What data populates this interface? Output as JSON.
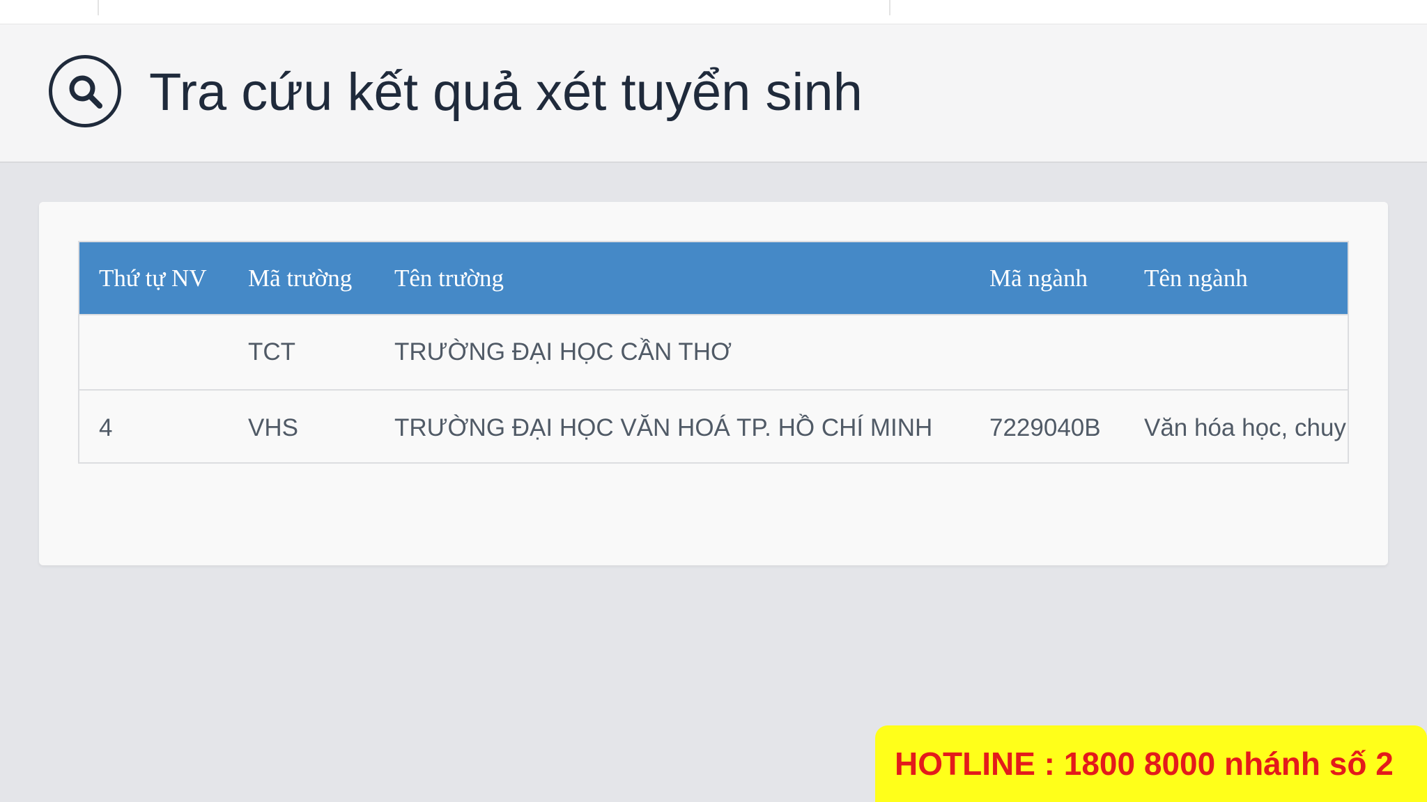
{
  "header": {
    "title": "Tra cứu kết quả xét tuyển sinh",
    "icon": "search-icon"
  },
  "table": {
    "columns": [
      "Thứ tự NV",
      "Mã trường",
      "Tên trường",
      "Mã ngành",
      "Tên ngành"
    ],
    "rows": [
      {
        "order": "",
        "school_code": "TCT",
        "school_name": "TRƯỜNG ĐẠI HỌC CẦN THƠ",
        "major_code": "",
        "major_name": ""
      },
      {
        "order": "4",
        "school_code": "VHS",
        "school_name": "TRƯỜNG ĐẠI HỌC VĂN HOÁ TP. HỒ CHÍ MINH",
        "major_code": "7229040B",
        "major_name": "Văn hóa học, chuy"
      }
    ]
  },
  "hotline": {
    "text": "HOTLINE : 1800 8000 nhánh số 2"
  },
  "colors": {
    "table_header": "#4589c7",
    "hotline_bg": "#ffff1a",
    "hotline_text": "#e31b1b",
    "title_text": "#1f2a3b"
  }
}
